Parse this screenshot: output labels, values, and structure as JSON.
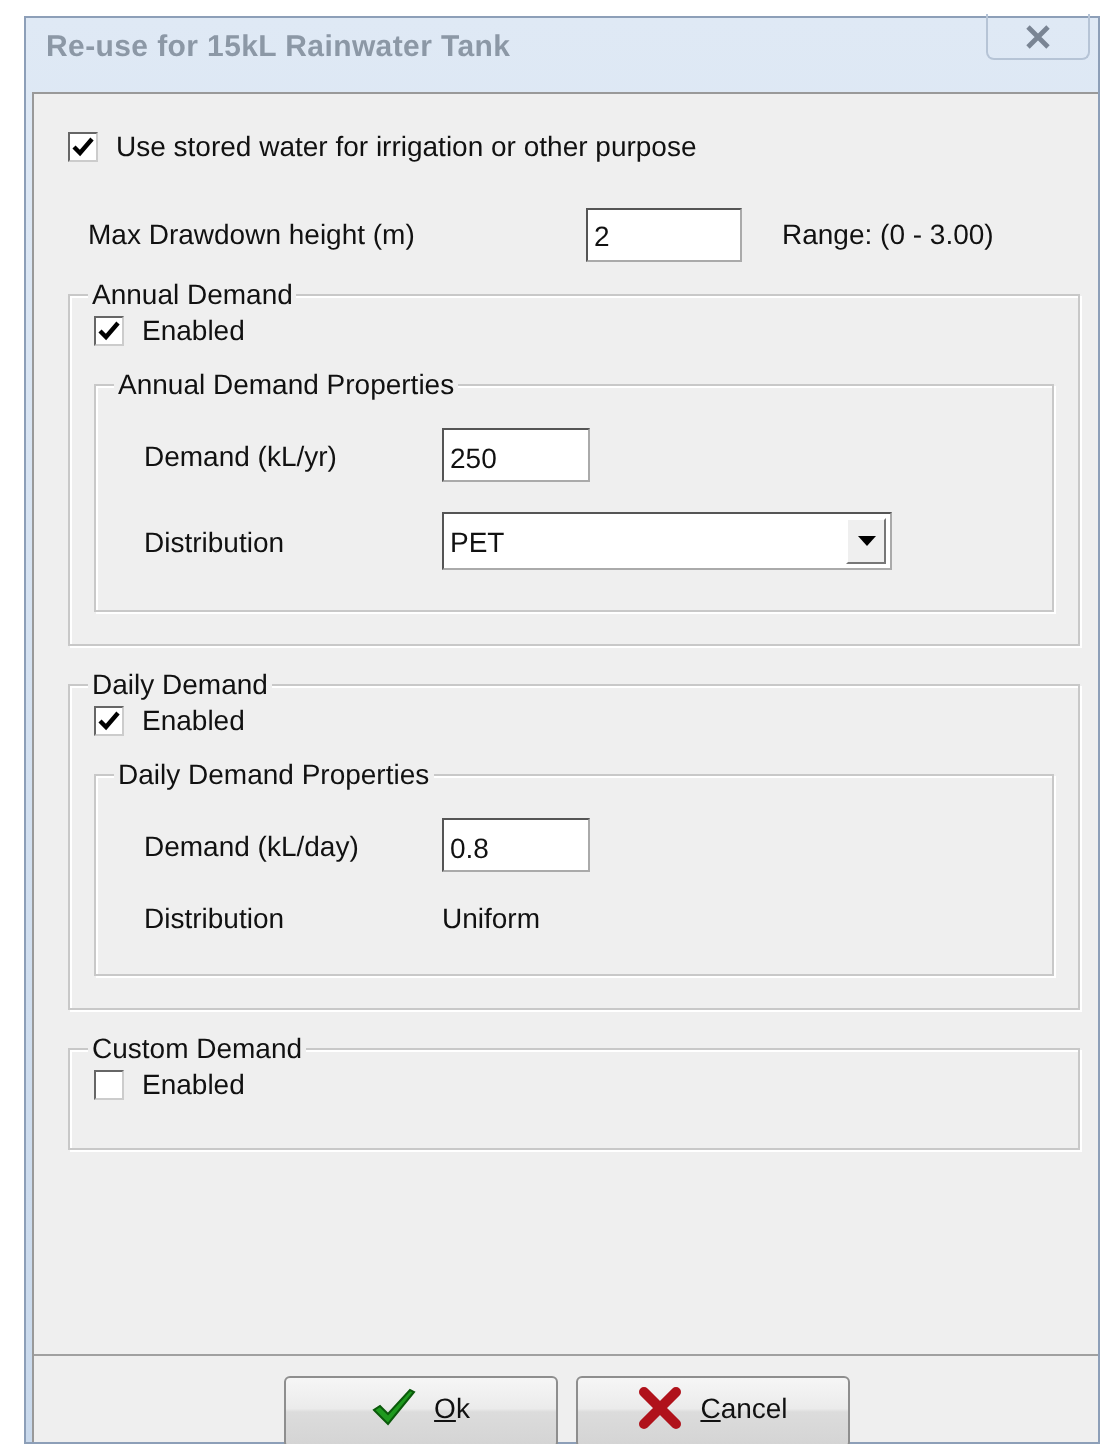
{
  "window": {
    "title": "Re-use for 15kL Rainwater Tank"
  },
  "use_stored_water": {
    "label": "Use stored water for irrigation or other purpose",
    "checked": true
  },
  "max_drawdown": {
    "label": "Max Drawdown height (m)",
    "value": "2",
    "range": "Range: (0 - 3.00)"
  },
  "groups": [
    {
      "title": "Annual Demand",
      "enabled": {
        "label": "Enabled",
        "checked": true
      },
      "properties": {
        "title": "Annual Demand Properties",
        "fields": [
          {
            "kind": "input",
            "label": "Demand (kL/yr)",
            "value": "250"
          },
          {
            "kind": "dropdown",
            "label": "Distribution",
            "value": "PET"
          }
        ]
      }
    },
    {
      "title": "Daily Demand",
      "enabled": {
        "label": "Enabled",
        "checked": true
      },
      "properties": {
        "title": "Daily Demand Properties",
        "fields": [
          {
            "kind": "input",
            "label": "Demand (kL/day)",
            "value": "0.8"
          },
          {
            "kind": "text",
            "label": "Distribution",
            "value": "Uniform"
          }
        ]
      }
    },
    {
      "title": "Custom Demand",
      "enabled": {
        "label": "Enabled",
        "checked": false
      }
    }
  ],
  "buttons": [
    {
      "kind": "ok",
      "label": "Ok"
    },
    {
      "kind": "cancel",
      "label": "Cancel"
    }
  ]
}
